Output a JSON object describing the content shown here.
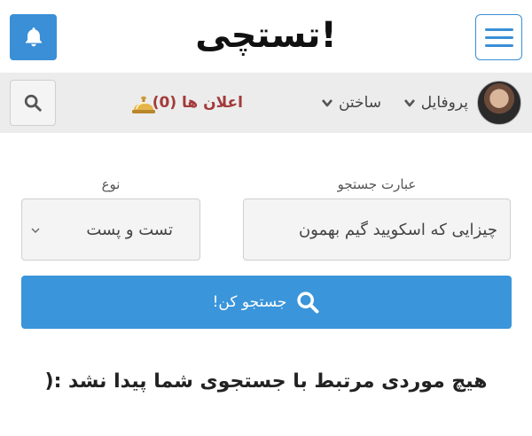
{
  "header": {
    "logo_text": "تستچی!",
    "bell_icon": "bell-icon",
    "menu_icon": "hamburger-icon"
  },
  "nav": {
    "profile_label": "پروفایل",
    "build_label": "ساختن",
    "notifications_label": "اعلان ها (0)",
    "search_icon": "search-icon",
    "gold_bell_icon": "service-bell-icon"
  },
  "search_form": {
    "query_label": "عبارت جستجو",
    "query_value": "چیزایی که اسکویید گیم بهمون",
    "type_label": "نوع",
    "type_value": "تست و پست",
    "submit_label": "جستجو کن!"
  },
  "results": {
    "empty_message": "هیچ موردی مرتبط با جستجوی شما پیدا نشد :("
  },
  "colors": {
    "accent": "#3a95da",
    "nav_bg": "#ececec",
    "notif_text": "#a33a3a"
  }
}
